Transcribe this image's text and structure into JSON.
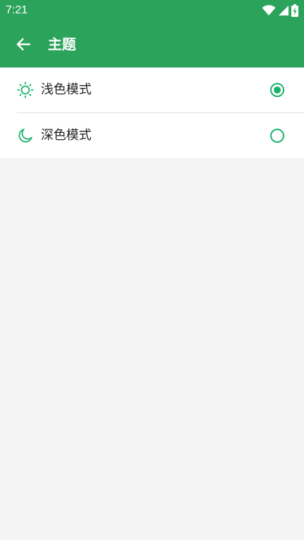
{
  "status_bar": {
    "time": "7:21",
    "icons": [
      "wifi-icon",
      "cellular-signal-icon",
      "battery-charging-icon"
    ]
  },
  "app_bar": {
    "back_icon": "arrow-left-icon",
    "title": "主题"
  },
  "theme_options": [
    {
      "icon": "sun-icon",
      "label": "浅色模式",
      "selected": true
    },
    {
      "icon": "moon-icon",
      "label": "深色模式",
      "selected": false
    }
  ],
  "colors": {
    "primary": "#2ba35b",
    "accent": "#19b36b",
    "background": "#f4f4f4",
    "surface": "#ffffff",
    "text": "#222222"
  }
}
